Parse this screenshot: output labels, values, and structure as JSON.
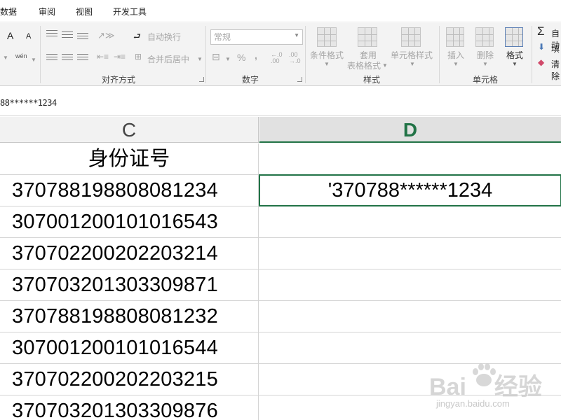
{
  "menubar": {
    "items": [
      "数据",
      "审阅",
      "视图",
      "开发工具"
    ]
  },
  "ribbon": {
    "font_group": {
      "grow_font_label": "A",
      "shrink_font_label": "A",
      "phonetic_label": "wén"
    },
    "alignment": {
      "wrap_text_label": "自动换行",
      "merge_center_label": "合并后居中",
      "group_label": "对齐方式"
    },
    "number": {
      "format_value": "常规",
      "percent_label": "%",
      "comma_label": ",",
      "inc_decimal_label": "←.0 .00",
      "dec_decimal_label": ".00 →.0",
      "group_label": "数字"
    },
    "styles": {
      "conditional_label": "条件格式",
      "table_label_1": "套用",
      "table_label_2": "表格格式",
      "cell_styles_label": "单元格样式",
      "group_label": "样式"
    },
    "cells": {
      "insert_label": "插入",
      "delete_label": "删除",
      "format_label": "格式",
      "group_label": "单元格"
    },
    "editing": {
      "autosum_label": "自动",
      "fill_label": "填",
      "clear_label": "清除"
    }
  },
  "formula_bar": {
    "content": "88******1234"
  },
  "grid": {
    "columns": [
      "C",
      "D"
    ],
    "selected_column": "D",
    "rows": [
      {
        "c": "身份证号",
        "d": ""
      },
      {
        "c": "370788198808081234",
        "d": "'370788******1234"
      },
      {
        "c": "307001200101016543",
        "d": ""
      },
      {
        "c": "370702200202203214",
        "d": ""
      },
      {
        "c": "370703201303309871",
        "d": ""
      },
      {
        "c": "370788198808081232",
        "d": ""
      },
      {
        "c": "307001200101016544",
        "d": ""
      },
      {
        "c": "370702200202203215",
        "d": ""
      },
      {
        "c": "370703201303309876",
        "d": ""
      }
    ]
  },
  "watermark": {
    "logo_text": "Bai",
    "logo_text_2": "经验",
    "url": "jingyan.baidu.com"
  },
  "colors": {
    "accent": "#217346",
    "ribbon_bg": "#f3f3f3",
    "header_bg": "#f2f2f2",
    "grid_line": "#d4d4d4"
  }
}
